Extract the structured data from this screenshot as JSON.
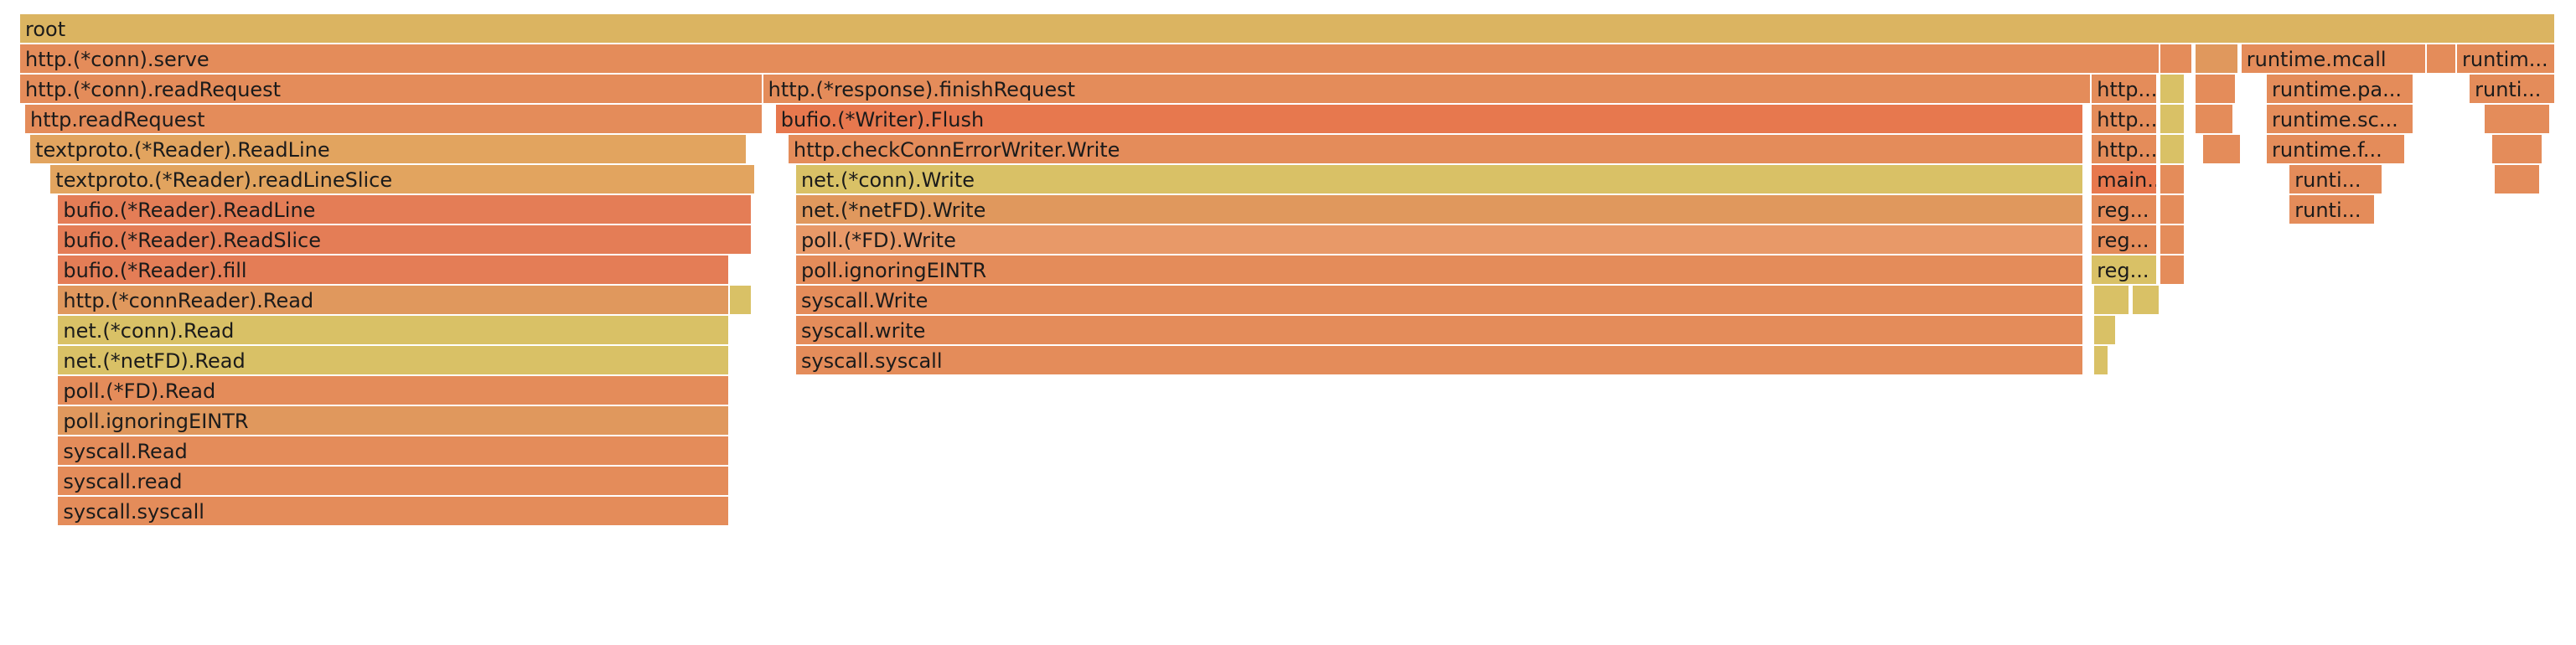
{
  "chart_data": {
    "type": "flamegraph",
    "colors": {
      "c1": "#dbb461",
      "c2": "#e48c5a",
      "c3": "#e0985d",
      "c4": "#e47d56",
      "c5": "#d9c166",
      "c6": "#e2a45f",
      "c7": "#e7784e",
      "c8": "#e89968"
    },
    "frames": [
      {
        "n": "root",
        "l": "root",
        "d": 0,
        "s": 0.0,
        "w": 100.0,
        "c": "c1"
      },
      {
        "n": "serve",
        "l": "http.(*conn).serve",
        "d": 1,
        "s": 0.0,
        "w": 84.4,
        "c": "c2"
      },
      {
        "n": "x1",
        "l": "",
        "d": 1,
        "s": 84.4,
        "w": 1.3,
        "c": "c2"
      },
      {
        "n": "x2",
        "l": "",
        "d": 1,
        "s": 85.8,
        "w": 1.7,
        "c": "c3"
      },
      {
        "n": "mcall",
        "l": "runtime.mcall",
        "d": 1,
        "s": 87.6,
        "w": 7.3,
        "c": "c2"
      },
      {
        "n": "x3",
        "l": "",
        "d": 1,
        "s": 94.9,
        "w": 1.2,
        "c": "c2"
      },
      {
        "n": "runtim1",
        "l": "runtim...",
        "d": 1,
        "s": 96.1,
        "w": 3.9,
        "c": "c2"
      },
      {
        "n": "readRequest_conn",
        "l": "http.(*conn).readRequest",
        "d": 2,
        "s": 0.0,
        "w": 29.3,
        "c": "c2"
      },
      {
        "n": "finishRequest",
        "l": "http.(*response).finishRequest",
        "d": 2,
        "s": 29.3,
        "w": 52.4,
        "c": "c2"
      },
      {
        "n": "http_a",
        "l": "http....",
        "d": 2,
        "s": 81.7,
        "w": 2.6,
        "c": "c2"
      },
      {
        "n": "x4",
        "l": "",
        "d": 2,
        "s": 84.4,
        "w": 1.0,
        "c": "c5"
      },
      {
        "n": "x5",
        "l": "",
        "d": 2,
        "s": 85.8,
        "w": 1.6,
        "c": "c2"
      },
      {
        "n": "park",
        "l": "runtime.pa...",
        "d": 2,
        "s": 88.6,
        "w": 5.8,
        "c": "c2"
      },
      {
        "n": "runti_b",
        "l": "runti...",
        "d": 2,
        "s": 96.6,
        "w": 3.4,
        "c": "c2"
      },
      {
        "n": "readRequest",
        "l": "http.readRequest",
        "d": 3,
        "s": 0.2,
        "w": 29.1,
        "c": "c2"
      },
      {
        "n": "flush",
        "l": "bufio.(*Writer).Flush",
        "d": 3,
        "s": 29.8,
        "w": 51.6,
        "c": "c7"
      },
      {
        "n": "http_b",
        "l": "http....",
        "d": 3,
        "s": 81.7,
        "w": 2.6,
        "c": "c2"
      },
      {
        "n": "x6",
        "l": "",
        "d": 3,
        "s": 84.4,
        "w": 1.0,
        "c": "c5"
      },
      {
        "n": "x7",
        "l": "",
        "d": 3,
        "s": 85.8,
        "w": 1.5,
        "c": "c2"
      },
      {
        "n": "schedule",
        "l": "runtime.sc...",
        "d": 3,
        "s": 88.6,
        "w": 5.8,
        "c": "c2"
      },
      {
        "n": "x8",
        "l": "",
        "d": 3,
        "s": 97.2,
        "w": 2.6,
        "c": "c2"
      },
      {
        "n": "readLine",
        "l": "textproto.(*Reader).ReadLine",
        "d": 4,
        "s": 0.4,
        "w": 28.3,
        "c": "c6"
      },
      {
        "n": "checkConnErr",
        "l": "http.checkConnErrorWriter.Write",
        "d": 4,
        "s": 30.3,
        "w": 51.1,
        "c": "c2"
      },
      {
        "n": "http_c",
        "l": "http....",
        "d": 4,
        "s": 81.7,
        "w": 2.6,
        "c": "c2"
      },
      {
        "n": "x9",
        "l": "",
        "d": 4,
        "s": 84.4,
        "w": 1.0,
        "c": "c5"
      },
      {
        "n": "x10",
        "l": "",
        "d": 4,
        "s": 86.1,
        "w": 1.5,
        "c": "c2"
      },
      {
        "n": "findrun",
        "l": "runtime.f...",
        "d": 4,
        "s": 88.6,
        "w": 5.5,
        "c": "c2"
      },
      {
        "n": "x11",
        "l": "",
        "d": 4,
        "s": 97.5,
        "w": 2.0,
        "c": "c2"
      },
      {
        "n": "readLineSlice",
        "l": "textproto.(*Reader).readLineSlice",
        "d": 5,
        "s": 1.2,
        "w": 27.8,
        "c": "c6"
      },
      {
        "n": "netConnWrite",
        "l": "net.(*conn).Write",
        "d": 5,
        "s": 30.6,
        "w": 50.8,
        "c": "c5"
      },
      {
        "n": "main_a",
        "l": "main....",
        "d": 5,
        "s": 81.7,
        "w": 2.6,
        "c": "c7"
      },
      {
        "n": "x12",
        "l": "",
        "d": 5,
        "s": 84.4,
        "w": 1.0,
        "c": "c2"
      },
      {
        "n": "runti_c",
        "l": "runti...",
        "d": 5,
        "s": 89.5,
        "w": 3.7,
        "c": "c2"
      },
      {
        "n": "x13",
        "l": "",
        "d": 5,
        "s": 97.6,
        "w": 1.8,
        "c": "c2"
      },
      {
        "n": "bufReadLine",
        "l": "bufio.(*Reader).ReadLine",
        "d": 6,
        "s": 1.5,
        "w": 27.4,
        "c": "c4"
      },
      {
        "n": "netFDWrite",
        "l": "net.(*netFD).Write",
        "d": 6,
        "s": 30.6,
        "w": 50.8,
        "c": "c3"
      },
      {
        "n": "reg_a",
        "l": "reg...",
        "d": 6,
        "s": 81.7,
        "w": 2.6,
        "c": "c2"
      },
      {
        "n": "x14",
        "l": "",
        "d": 6,
        "s": 84.4,
        "w": 1.0,
        "c": "c2"
      },
      {
        "n": "runti_d",
        "l": "runti...",
        "d": 6,
        "s": 89.5,
        "w": 3.4,
        "c": "c2"
      },
      {
        "n": "readSlice",
        "l": "bufio.(*Reader).ReadSlice",
        "d": 7,
        "s": 1.5,
        "w": 27.4,
        "c": "c4"
      },
      {
        "n": "fdWrite",
        "l": "poll.(*FD).Write",
        "d": 7,
        "s": 30.6,
        "w": 50.8,
        "c": "c8"
      },
      {
        "n": "reg_b",
        "l": "reg...",
        "d": 7,
        "s": 81.7,
        "w": 2.6,
        "c": "c2"
      },
      {
        "n": "x15",
        "l": "",
        "d": 7,
        "s": 84.4,
        "w": 1.0,
        "c": "c2"
      },
      {
        "n": "fill",
        "l": "bufio.(*Reader).fill",
        "d": 8,
        "s": 1.5,
        "w": 26.5,
        "c": "c4"
      },
      {
        "n": "ignEINTR_w",
        "l": "poll.ignoringEINTR",
        "d": 8,
        "s": 30.6,
        "w": 50.8,
        "c": "c2"
      },
      {
        "n": "reg_c",
        "l": "reg...",
        "d": 8,
        "s": 81.7,
        "w": 2.6,
        "c": "c5"
      },
      {
        "n": "x16",
        "l": "",
        "d": 8,
        "s": 84.4,
        "w": 1.0,
        "c": "c2"
      },
      {
        "n": "connReaderRead",
        "l": "http.(*connReader).Read",
        "d": 9,
        "s": 1.5,
        "w": 26.5,
        "c": "c3"
      },
      {
        "n": "x17",
        "l": "",
        "d": 9,
        "s": 28.0,
        "w": 0.9,
        "c": "c5"
      },
      {
        "n": "syscallWrite",
        "l": "syscall.Write",
        "d": 9,
        "s": 30.6,
        "w": 50.8,
        "c": "c2"
      },
      {
        "n": "x18",
        "l": "",
        "d": 9,
        "s": 81.8,
        "w": 1.4,
        "c": "c5"
      },
      {
        "n": "x19",
        "l": "",
        "d": 9,
        "s": 83.3,
        "w": 1.1,
        "c": "c5"
      },
      {
        "n": "netConnRead",
        "l": "net.(*conn).Read",
        "d": 10,
        "s": 1.5,
        "w": 26.5,
        "c": "c5"
      },
      {
        "n": "syscall_write",
        "l": "syscall.write",
        "d": 10,
        "s": 30.6,
        "w": 50.8,
        "c": "c2"
      },
      {
        "n": "x20",
        "l": "",
        "d": 10,
        "s": 81.8,
        "w": 0.9,
        "c": "c5"
      },
      {
        "n": "netFDRead",
        "l": "net.(*netFD).Read",
        "d": 11,
        "s": 1.5,
        "w": 26.5,
        "c": "c5"
      },
      {
        "n": "syscall_syscall_w",
        "l": "syscall.syscall",
        "d": 11,
        "s": 30.6,
        "w": 50.8,
        "c": "c2"
      },
      {
        "n": "x21",
        "l": "",
        "d": 11,
        "s": 81.8,
        "w": 0.6,
        "c": "c5"
      },
      {
        "n": "fdRead",
        "l": "poll.(*FD).Read",
        "d": 12,
        "s": 1.5,
        "w": 26.5,
        "c": "c2"
      },
      {
        "n": "ignEINTR_r",
        "l": "poll.ignoringEINTR",
        "d": 13,
        "s": 1.5,
        "w": 26.5,
        "c": "c3"
      },
      {
        "n": "syscallRead",
        "l": "syscall.Read",
        "d": 14,
        "s": 1.5,
        "w": 26.5,
        "c": "c2"
      },
      {
        "n": "syscall_read",
        "l": "syscall.read",
        "d": 15,
        "s": 1.5,
        "w": 26.5,
        "c": "c2"
      },
      {
        "n": "syscall_syscall_r",
        "l": "syscall.syscall",
        "d": 16,
        "s": 1.5,
        "w": 26.5,
        "c": "c2"
      }
    ]
  }
}
